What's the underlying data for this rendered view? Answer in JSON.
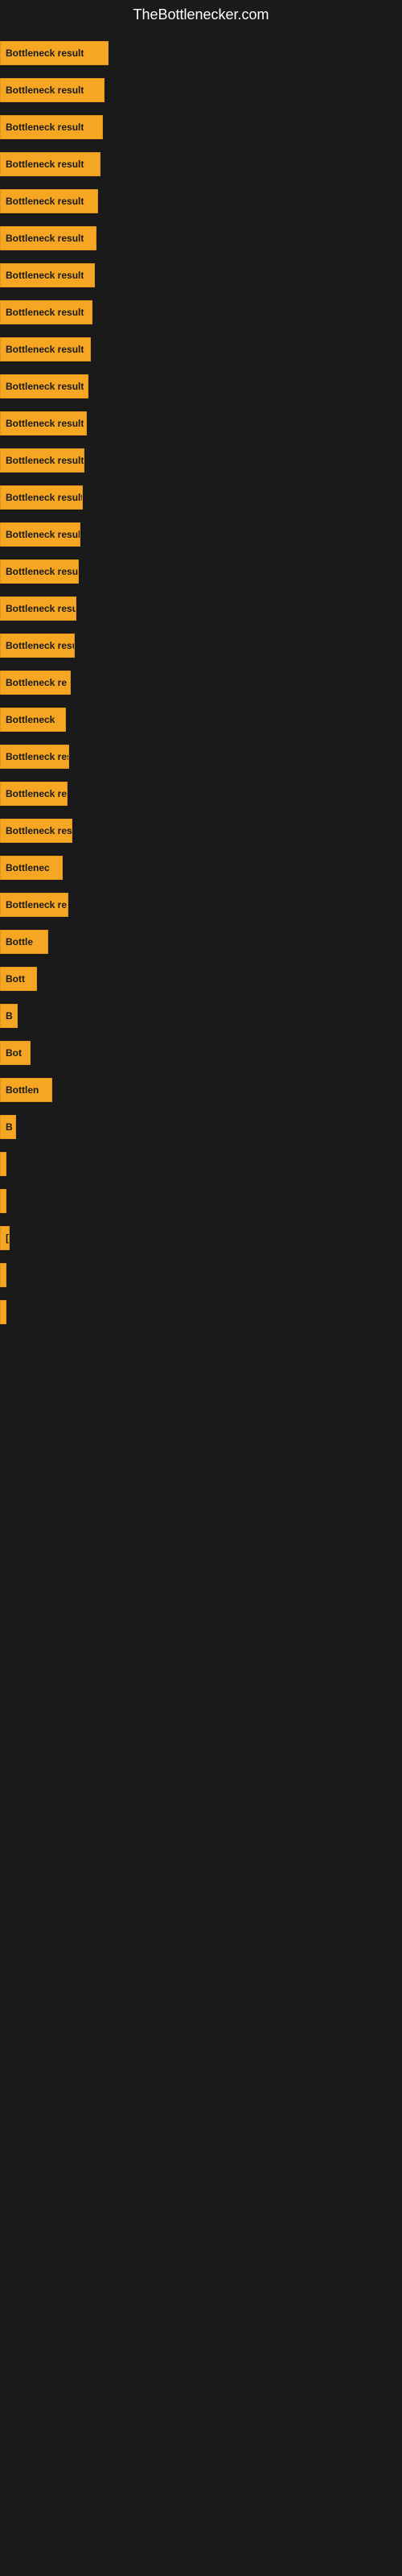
{
  "site": {
    "title": "TheBottlenecker.com"
  },
  "bars": [
    {
      "label": "Bottleneck result",
      "width": 135
    },
    {
      "label": "Bottleneck result",
      "width": 130
    },
    {
      "label": "Bottleneck result",
      "width": 128
    },
    {
      "label": "Bottleneck result",
      "width": 125
    },
    {
      "label": "Bottleneck result",
      "width": 122
    },
    {
      "label": "Bottleneck result",
      "width": 120
    },
    {
      "label": "Bottleneck result",
      "width": 118
    },
    {
      "label": "Bottleneck result",
      "width": 115
    },
    {
      "label": "Bottleneck result",
      "width": 113
    },
    {
      "label": "Bottleneck result",
      "width": 110
    },
    {
      "label": "Bottleneck result",
      "width": 108
    },
    {
      "label": "Bottleneck result",
      "width": 105
    },
    {
      "label": "Bottleneck result",
      "width": 103
    },
    {
      "label": "Bottleneck result",
      "width": 100
    },
    {
      "label": "Bottleneck result",
      "width": 98
    },
    {
      "label": "Bottleneck resu",
      "width": 95
    },
    {
      "label": "Bottleneck result",
      "width": 93
    },
    {
      "label": "Bottleneck re",
      "width": 88
    },
    {
      "label": "Bottleneck",
      "width": 82
    },
    {
      "label": "Bottleneck res",
      "width": 86
    },
    {
      "label": "Bottleneck re",
      "width": 84
    },
    {
      "label": "Bottleneck resu",
      "width": 90
    },
    {
      "label": "Bottlenec",
      "width": 78
    },
    {
      "label": "Bottleneck re",
      "width": 85
    },
    {
      "label": "Bottle",
      "width": 60
    },
    {
      "label": "Bott",
      "width": 46
    },
    {
      "label": "B",
      "width": 22
    },
    {
      "label": "Bot",
      "width": 38
    },
    {
      "label": "Bottlen",
      "width": 65
    },
    {
      "label": "B",
      "width": 20
    },
    {
      "label": "",
      "width": 8
    },
    {
      "label": "",
      "width": 4
    },
    {
      "label": "[",
      "width": 12
    },
    {
      "label": "",
      "width": 4
    },
    {
      "label": "",
      "width": 3
    }
  ]
}
